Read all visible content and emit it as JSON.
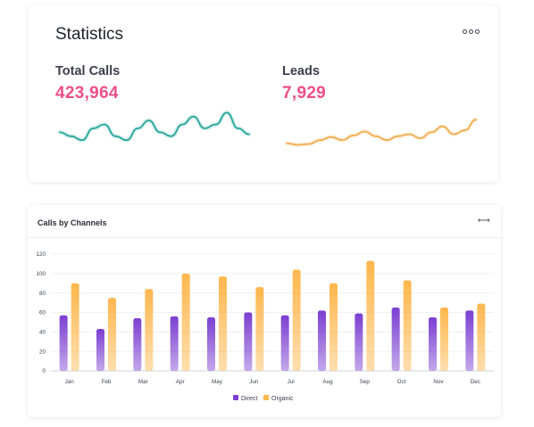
{
  "statistics": {
    "title": "Statistics",
    "menu_icon": "more-dots-icon",
    "metrics": [
      {
        "label": "Total Calls",
        "value": "423,964",
        "color": "#26a69a",
        "trend": [
          0.4,
          0.3,
          0.2,
          0.5,
          0.6,
          0.3,
          0.2,
          0.5,
          0.7,
          0.4,
          0.3,
          0.6,
          0.8,
          0.5,
          0.6,
          0.9,
          0.5,
          0.35
        ]
      },
      {
        "label": "Leads",
        "value": "7,929",
        "color": "#f0ad4e",
        "trend": [
          0.12,
          0.08,
          0.1,
          0.2,
          0.28,
          0.2,
          0.32,
          0.42,
          0.3,
          0.2,
          0.3,
          0.35,
          0.25,
          0.4,
          0.55,
          0.35,
          0.45,
          0.72
        ]
      }
    ],
    "value_color": "#ec4f86"
  },
  "channels": {
    "title": "Calls by Channels",
    "expand_icon": "expand-arrows-icon"
  },
  "chart_data": {
    "type": "bar",
    "title": "Calls by Channels",
    "categories": [
      "Jan",
      "Feb",
      "Mar",
      "Apr",
      "May",
      "Jun",
      "Jul",
      "Aug",
      "Sep",
      "Oct",
      "Nov",
      "Dec"
    ],
    "series": [
      {
        "name": "Direct",
        "values": [
          57,
          43,
          54,
          56,
          55,
          60,
          57,
          62,
          59,
          65,
          55,
          62
        ],
        "color": "#7b3fd1"
      },
      {
        "name": "Organic",
        "values": [
          90,
          75,
          84,
          100,
          97,
          86,
          104,
          90,
          113,
          93,
          65,
          69
        ],
        "color": "#ffb74d"
      }
    ],
    "ylim": [
      0,
      120
    ],
    "yticks": [
      0,
      20,
      40,
      60,
      80,
      100,
      120
    ],
    "grid": true,
    "legend": "bottom-center"
  }
}
